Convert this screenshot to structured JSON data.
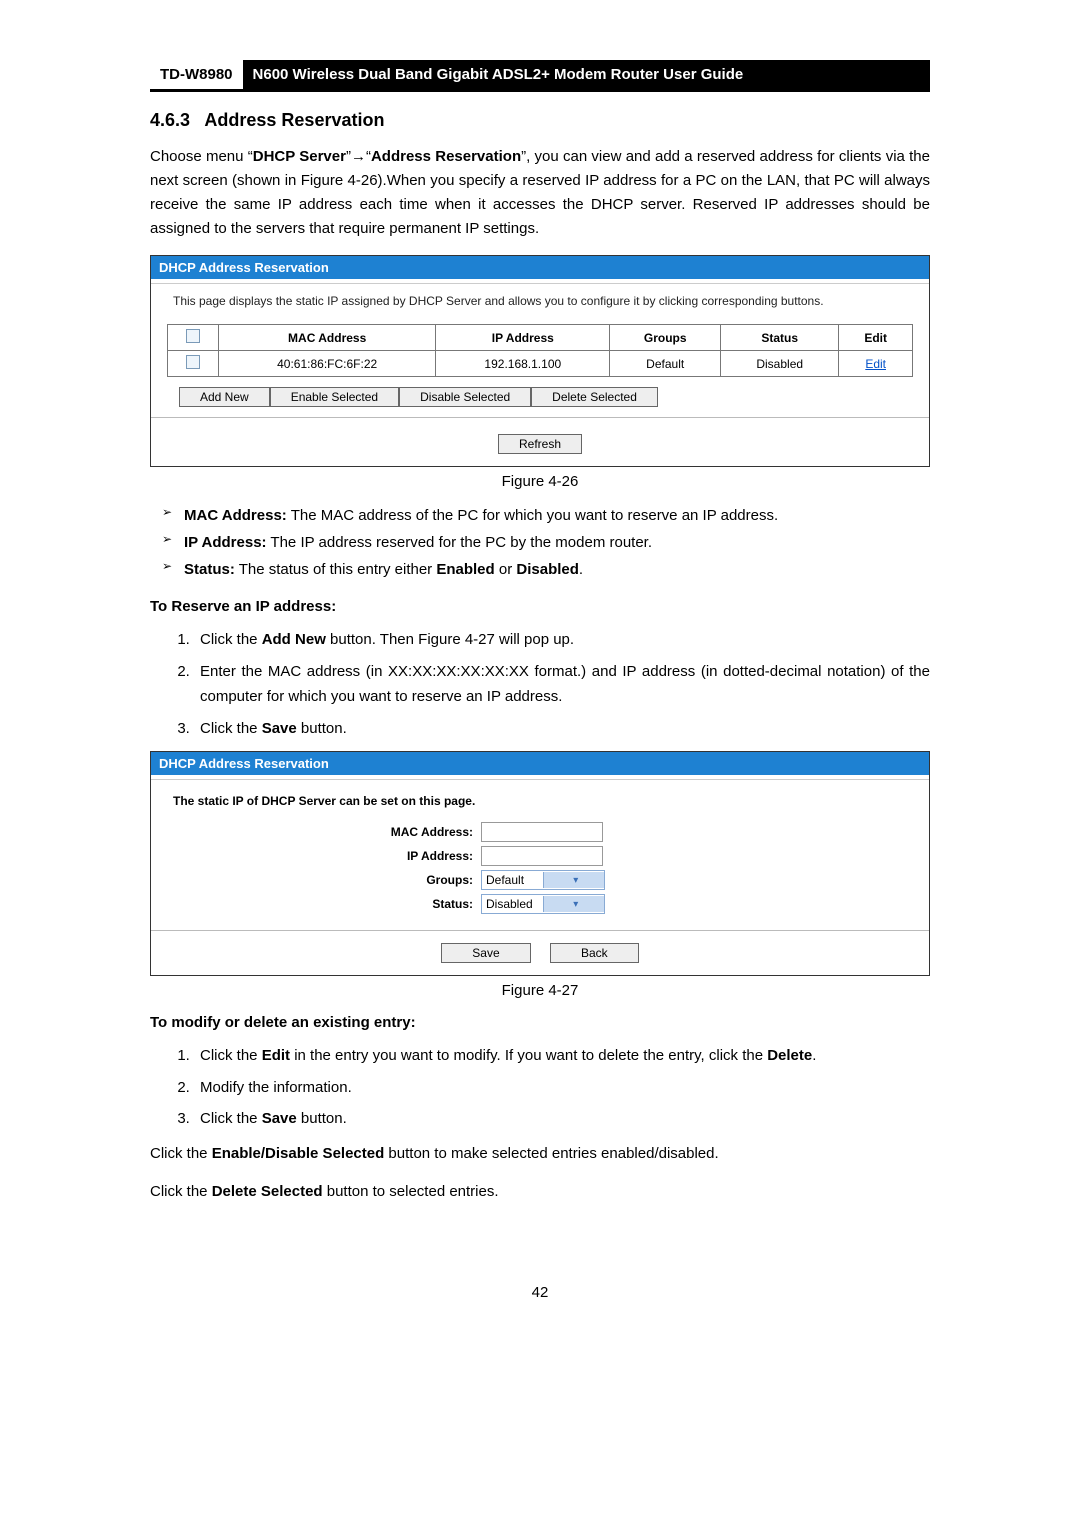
{
  "header": {
    "model": "TD-W8980",
    "title": "N600 Wireless Dual Band Gigabit ADSL2+ Modem Router User Guide"
  },
  "section": {
    "number": "4.6.3",
    "title": "Address Reservation"
  },
  "intro": {
    "pre": "Choose menu “",
    "menu1": "DHCP Server",
    "arrow": "”→“",
    "menu2": "Address Reservation",
    "post": "”, you can view and add a reserved address for clients via the next screen (shown in Figure 4-26).When you specify a reserved IP address for a PC on the LAN, that PC will always receive the same IP address each time when it accesses the DHCP server. Reserved IP addresses should be assigned to the servers that require permanent IP settings."
  },
  "fig1": {
    "titlebar": "DHCP Address Reservation",
    "desc": "This page displays the static IP assigned by DHCP Server and allows you to configure it by clicking corresponding buttons.",
    "headers": {
      "mac": "MAC Address",
      "ip": "IP Address",
      "groups": "Groups",
      "status": "Status",
      "edit": "Edit"
    },
    "row": {
      "mac": "40:61:86:FC:6F:22",
      "ip": "192.168.1.100",
      "groups": "Default",
      "status": "Disabled",
      "edit": "Edit"
    },
    "btns": {
      "add": "Add New",
      "enable": "Enable Selected",
      "disable": "Disable Selected",
      "delete": "Delete Selected",
      "refresh": "Refresh"
    },
    "caption": "Figure 4-26"
  },
  "bullets": {
    "b1_label": "MAC Address:",
    "b1_text": " The MAC address of the PC for which you want to reserve an IP address.",
    "b2_label": "IP Address:",
    "b2_text": " The IP address reserved for the PC by the modem router.",
    "b3_label": "Status:",
    "b3_text_pre": " The status of this entry either ",
    "b3_en": "Enabled",
    "b3_or": " or ",
    "b3_dis": "Disabled",
    "b3_end": "."
  },
  "reserve_heading": "To Reserve an IP address:",
  "reserve_steps": {
    "s1_pre": "Click the ",
    "s1_btn": "Add New",
    "s1_post": " button. Then Figure 4-27 will pop up.",
    "s2": "Enter the MAC address (in XX:XX:XX:XX:XX:XX format.) and IP address (in dotted-decimal notation) of the computer for which you want to reserve an IP address.",
    "s3_pre": "Click the ",
    "s3_btn": "Save",
    "s3_post": " button."
  },
  "fig2": {
    "titlebar": "DHCP Address Reservation",
    "desc": "The static IP of DHCP Server can be set on this page.",
    "labels": {
      "mac": "MAC Address:",
      "ip": "IP Address:",
      "groups": "Groups:",
      "status": "Status:"
    },
    "values": {
      "groups": "Default",
      "status": "Disabled"
    },
    "btns": {
      "save": "Save",
      "back": "Back"
    },
    "caption": "Figure 4-27"
  },
  "modify_heading": "To modify or delete an existing entry:",
  "modify_steps": {
    "s1_pre": "Click the ",
    "s1_edit": "Edit",
    "s1_mid": " in the entry you want to modify. If you want to delete the entry, click the ",
    "s1_del": "Delete",
    "s1_end": ".",
    "s2": "Modify the information.",
    "s3_pre": "Click the ",
    "s3_btn": "Save",
    "s3_post": " button."
  },
  "tail1_pre": "Click the ",
  "tail1_btn": "Enable/Disable Selected",
  "tail1_post": " button to make selected entries enabled/disabled.",
  "tail2_pre": "Click the ",
  "tail2_btn": "Delete Selected",
  "tail2_post": " button to selected entries.",
  "page_number": "42"
}
